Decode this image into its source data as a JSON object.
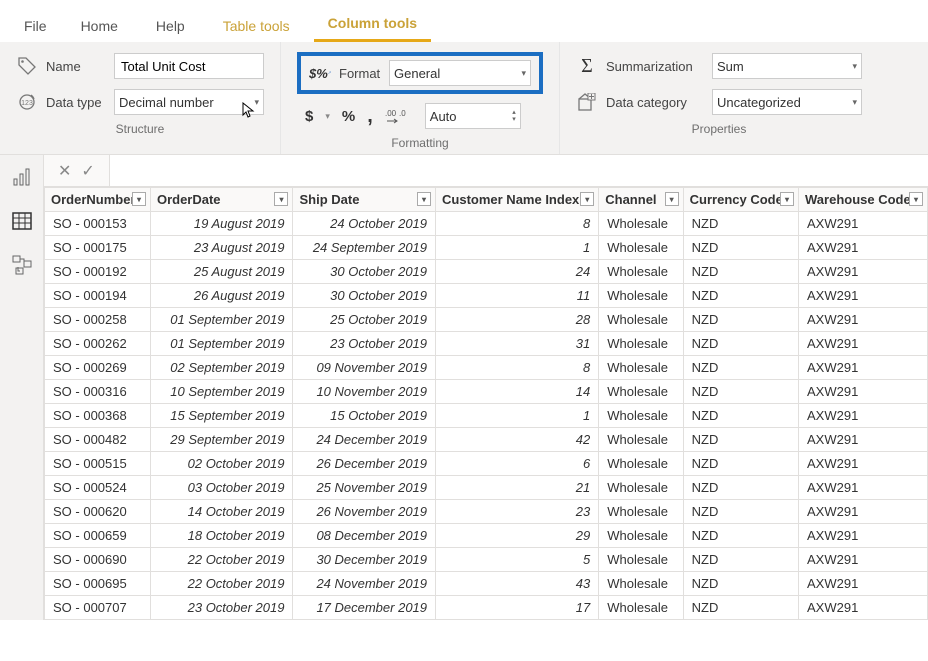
{
  "tabs": {
    "file": "File",
    "home": "Home",
    "help": "Help",
    "table_tools": "Table tools",
    "column_tools": "Column tools"
  },
  "ribbon": {
    "structure": {
      "label": "Structure",
      "name_label": "Name",
      "name_value": "Total Unit Cost",
      "datatype_label": "Data type",
      "datatype_value": "Decimal number"
    },
    "formatting": {
      "label": "Formatting",
      "format_label": "Format",
      "format_value": "General",
      "dollar": "$",
      "percent": "%",
      "comma": ",",
      "decimals_value": "Auto"
    },
    "properties": {
      "label": "Properties",
      "summ_label": "Summarization",
      "summ_value": "Sum",
      "datacat_label": "Data category",
      "datacat_value": "Uncategorized"
    }
  },
  "table": {
    "headers": [
      "OrderNumber",
      "OrderDate",
      "Ship Date",
      "Customer Name Index",
      "Channel",
      "Currency Code",
      "Warehouse Code"
    ],
    "rows": [
      {
        "order": "SO - 000153",
        "odate": "19 August 2019",
        "sdate": "24 October 2019",
        "cidx": "8",
        "chan": "Wholesale",
        "cur": "NZD",
        "wh": "AXW291"
      },
      {
        "order": "SO - 000175",
        "odate": "23 August 2019",
        "sdate": "24 September 2019",
        "cidx": "1",
        "chan": "Wholesale",
        "cur": "NZD",
        "wh": "AXW291"
      },
      {
        "order": "SO - 000192",
        "odate": "25 August 2019",
        "sdate": "30 October 2019",
        "cidx": "24",
        "chan": "Wholesale",
        "cur": "NZD",
        "wh": "AXW291"
      },
      {
        "order": "SO - 000194",
        "odate": "26 August 2019",
        "sdate": "30 October 2019",
        "cidx": "11",
        "chan": "Wholesale",
        "cur": "NZD",
        "wh": "AXW291"
      },
      {
        "order": "SO - 000258",
        "odate": "01 September 2019",
        "sdate": "25 October 2019",
        "cidx": "28",
        "chan": "Wholesale",
        "cur": "NZD",
        "wh": "AXW291"
      },
      {
        "order": "SO - 000262",
        "odate": "01 September 2019",
        "sdate": "23 October 2019",
        "cidx": "31",
        "chan": "Wholesale",
        "cur": "NZD",
        "wh": "AXW291"
      },
      {
        "order": "SO - 000269",
        "odate": "02 September 2019",
        "sdate": "09 November 2019",
        "cidx": "8",
        "chan": "Wholesale",
        "cur": "NZD",
        "wh": "AXW291"
      },
      {
        "order": "SO - 000316",
        "odate": "10 September 2019",
        "sdate": "10 November 2019",
        "cidx": "14",
        "chan": "Wholesale",
        "cur": "NZD",
        "wh": "AXW291"
      },
      {
        "order": "SO - 000368",
        "odate": "15 September 2019",
        "sdate": "15 October 2019",
        "cidx": "1",
        "chan": "Wholesale",
        "cur": "NZD",
        "wh": "AXW291"
      },
      {
        "order": "SO - 000482",
        "odate": "29 September 2019",
        "sdate": "24 December 2019",
        "cidx": "42",
        "chan": "Wholesale",
        "cur": "NZD",
        "wh": "AXW291"
      },
      {
        "order": "SO - 000515",
        "odate": "02 October 2019",
        "sdate": "26 December 2019",
        "cidx": "6",
        "chan": "Wholesale",
        "cur": "NZD",
        "wh": "AXW291"
      },
      {
        "order": "SO - 000524",
        "odate": "03 October 2019",
        "sdate": "25 November 2019",
        "cidx": "21",
        "chan": "Wholesale",
        "cur": "NZD",
        "wh": "AXW291"
      },
      {
        "order": "SO - 000620",
        "odate": "14 October 2019",
        "sdate": "26 November 2019",
        "cidx": "23",
        "chan": "Wholesale",
        "cur": "NZD",
        "wh": "AXW291"
      },
      {
        "order": "SO - 000659",
        "odate": "18 October 2019",
        "sdate": "08 December 2019",
        "cidx": "29",
        "chan": "Wholesale",
        "cur": "NZD",
        "wh": "AXW291"
      },
      {
        "order": "SO - 000690",
        "odate": "22 October 2019",
        "sdate": "30 December 2019",
        "cidx": "5",
        "chan": "Wholesale",
        "cur": "NZD",
        "wh": "AXW291"
      },
      {
        "order": "SO - 000695",
        "odate": "22 October 2019",
        "sdate": "24 November 2019",
        "cidx": "43",
        "chan": "Wholesale",
        "cur": "NZD",
        "wh": "AXW291"
      },
      {
        "order": "SO - 000707",
        "odate": "23 October 2019",
        "sdate": "17 December 2019",
        "cidx": "17",
        "chan": "Wholesale",
        "cur": "NZD",
        "wh": "AXW291"
      }
    ]
  }
}
